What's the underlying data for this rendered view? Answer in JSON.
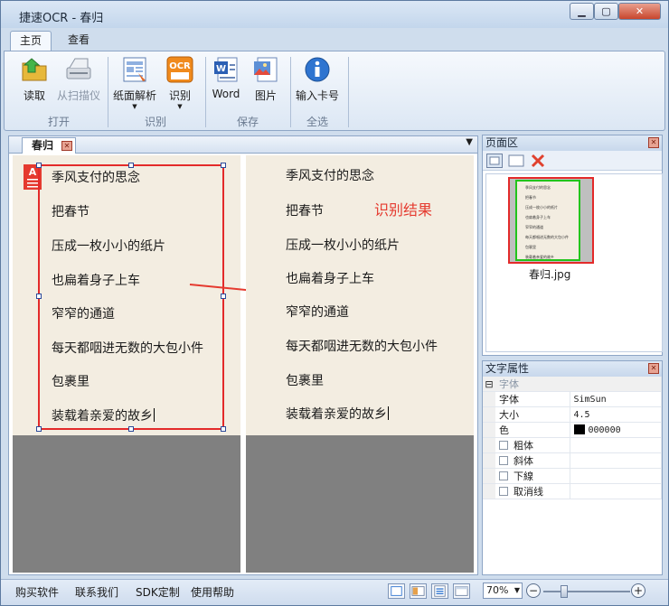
{
  "window": {
    "title": "捷速OCR - 春归"
  },
  "ribbon_tabs": [
    "主页",
    "查看"
  ],
  "ribbon": {
    "open_label": "读取",
    "scan_label": "从扫描仪",
    "group_open": "打开",
    "parse_label": "纸面解析",
    "recognize_label": "识别",
    "group_recognize": "识别",
    "word_label": "Word",
    "image_label": "图片",
    "group_save": "保存",
    "card_label": "输入卡号",
    "group_select_all": "全选"
  },
  "document": {
    "tab_label": "春归",
    "lines": [
      "季风支付的思念",
      "把春节",
      "压成一枚小小的纸片",
      "也扁着身子上车",
      "窄窄的通道",
      "每天都咽进无数的大包小件",
      "包裹里",
      "装载着亲爱的故乡"
    ],
    "result_label": "识别结果",
    "colors": {
      "selection": "#e32a2a",
      "annotation": "#e53a2f"
    }
  },
  "page_panel": {
    "title": "页面区",
    "thumbnail_name": "春归.jpg"
  },
  "text_props": {
    "title": "文字属性",
    "category": "字体",
    "font_label": "字体",
    "font_value": "SimSun",
    "size_label": "大小",
    "size_value": "4.5",
    "color_label": "色",
    "color_value": "000000",
    "bold_label": "粗体",
    "italic_label": "斜体",
    "underline_label": "下線",
    "strike_label": "取消线"
  },
  "status": {
    "buy": "购买软件",
    "contact": "联系我们",
    "sdk": "SDK定制",
    "help": "使用帮助",
    "zoom": "70%"
  }
}
